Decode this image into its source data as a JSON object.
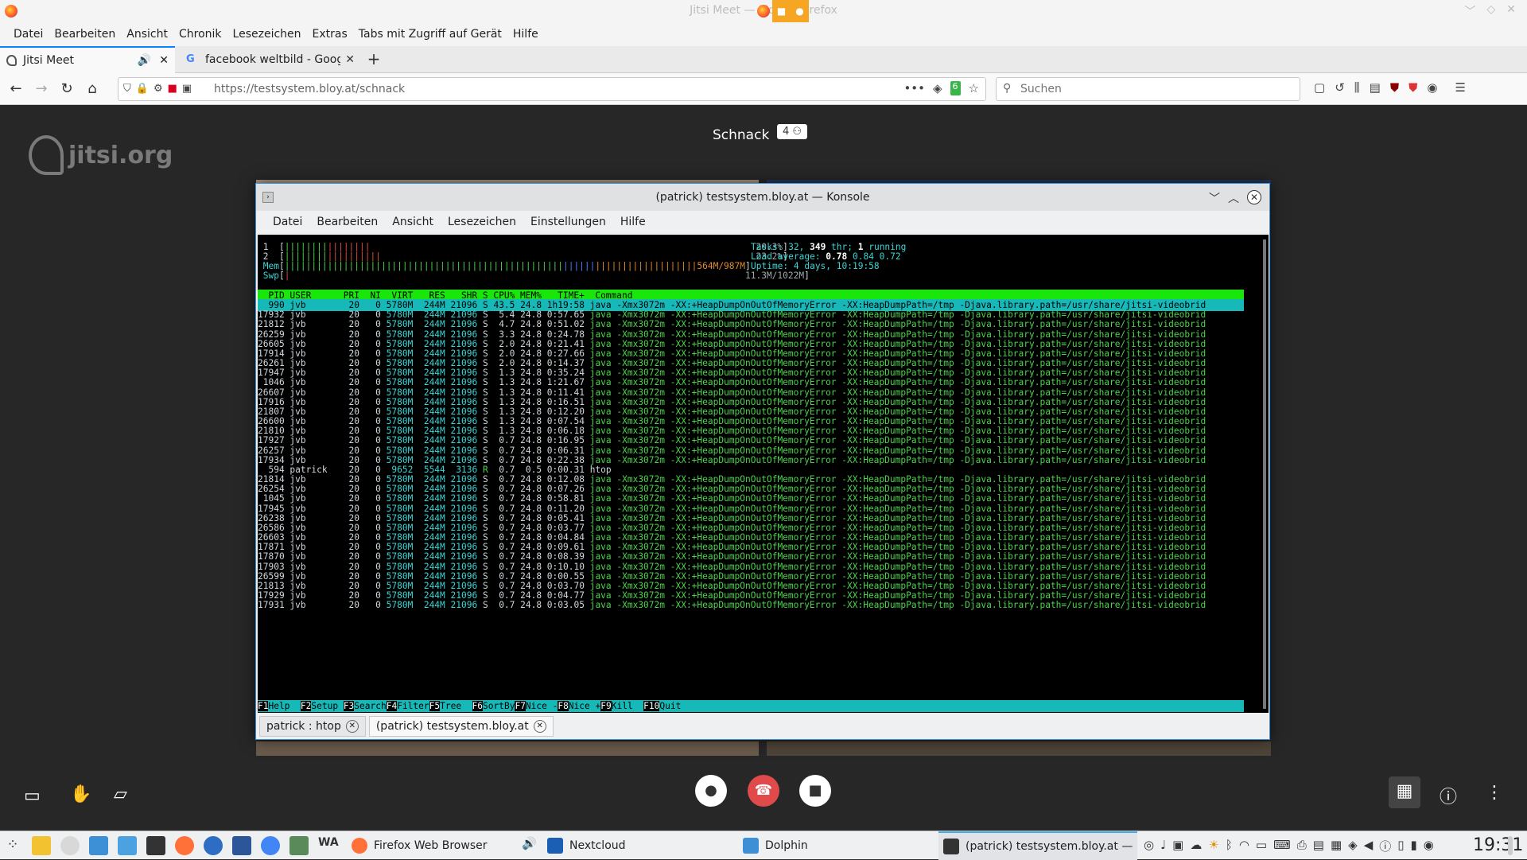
{
  "window": {
    "title": "Jitsi Meet — Mozilla Firefox"
  },
  "menubar": [
    "Datei",
    "Bearbeiten",
    "Ansicht",
    "Chronik",
    "Lesezeichen",
    "Extras",
    "Tabs mit Zugriff auf Gerät",
    "Hilfe"
  ],
  "tabs": [
    {
      "label": "Jitsi Meet",
      "active": true
    },
    {
      "label": "facebook weltbild - Google"
    }
  ],
  "url": "https://testsystem.bloy.at/schnack",
  "url_badge": "6",
  "search": {
    "placeholder": "Suchen"
  },
  "jitsi": {
    "logo": "jitsi.org",
    "room": "Schnack",
    "participants": "4"
  },
  "konsole": {
    "title": "(patrick) testsystem.bloy.at — Konsole",
    "menu": [
      "Datei",
      "Bearbeiten",
      "Ansicht",
      "Lesezeichen",
      "Einstellungen",
      "Hilfe"
    ],
    "tabs": [
      "patrick : htop",
      "(patrick) testsystem.bloy.at"
    ]
  },
  "htop": {
    "cpu1": "20.3%",
    "cpu2": "23.2%",
    "mem": "564M/987M",
    "swp": "11.3M/1022M",
    "tasks_line": [
      "Tasks: 32, ",
      "349",
      " thr; ",
      "1",
      " running"
    ],
    "load_line": [
      "Load average: ",
      "0.78",
      " 0.84 0.72"
    ],
    "uptime": "Uptime: 4 days, 10:19:58",
    "header": "  PID USER      PRI  NI  VIRT   RES   SHR S CPU% MEM%   TIME+  Command",
    "cmd": "java -Xmx3072m -XX:+HeapDumpOnOutOfMemoryError -XX:HeapDumpPath=/tmp -Djava.library.path=/usr/share/jitsi-videobrid",
    "rows": [
      [
        "990",
        "jvb",
        "20",
        "0",
        "5780M",
        "244M",
        "21096",
        "S",
        "43.5",
        "24.8",
        "1h19:58"
      ],
      [
        "17932",
        "jvb",
        "20",
        "0",
        "5780M",
        "244M",
        "21096",
        "S",
        "5.4",
        "24.8",
        "0:57.65"
      ],
      [
        "21812",
        "jvb",
        "20",
        "0",
        "5780M",
        "244M",
        "21096",
        "S",
        "4.7",
        "24.8",
        "0:51.02"
      ],
      [
        "26259",
        "jvb",
        "20",
        "0",
        "5780M",
        "244M",
        "21096",
        "S",
        "3.3",
        "24.8",
        "0:24.78"
      ],
      [
        "26605",
        "jvb",
        "20",
        "0",
        "5780M",
        "244M",
        "21096",
        "S",
        "2.0",
        "24.8",
        "0:21.41"
      ],
      [
        "17914",
        "jvb",
        "20",
        "0",
        "5780M",
        "244M",
        "21096",
        "S",
        "2.0",
        "24.8",
        "0:27.66"
      ],
      [
        "26261",
        "jvb",
        "20",
        "0",
        "5780M",
        "244M",
        "21096",
        "S",
        "2.0",
        "24.8",
        "0:14.37"
      ],
      [
        "17947",
        "jvb",
        "20",
        "0",
        "5780M",
        "244M",
        "21096",
        "S",
        "1.3",
        "24.8",
        "0:35.24"
      ],
      [
        "1046",
        "jvb",
        "20",
        "0",
        "5780M",
        "244M",
        "21096",
        "S",
        "1.3",
        "24.8",
        "1:21.67"
      ],
      [
        "26607",
        "jvb",
        "20",
        "0",
        "5780M",
        "244M",
        "21096",
        "S",
        "1.3",
        "24.8",
        "0:11.41"
      ],
      [
        "17916",
        "jvb",
        "20",
        "0",
        "5780M",
        "244M",
        "21096",
        "S",
        "1.3",
        "24.8",
        "0:16.51"
      ],
      [
        "21807",
        "jvb",
        "20",
        "0",
        "5780M",
        "244M",
        "21096",
        "S",
        "1.3",
        "24.8",
        "0:12.20"
      ],
      [
        "26600",
        "jvb",
        "20",
        "0",
        "5780M",
        "244M",
        "21096",
        "S",
        "1.3",
        "24.8",
        "0:07.54"
      ],
      [
        "21810",
        "jvb",
        "20",
        "0",
        "5780M",
        "244M",
        "21096",
        "S",
        "1.3",
        "24.8",
        "0:06.18"
      ],
      [
        "17927",
        "jvb",
        "20",
        "0",
        "5780M",
        "244M",
        "21096",
        "S",
        "0.7",
        "24.8",
        "0:16.95"
      ],
      [
        "26257",
        "jvb",
        "20",
        "0",
        "5780M",
        "244M",
        "21096",
        "S",
        "0.7",
        "24.8",
        "0:06.31"
      ],
      [
        "17934",
        "jvb",
        "20",
        "0",
        "5780M",
        "244M",
        "21096",
        "S",
        "0.7",
        "24.8",
        "0:22.38"
      ],
      [
        "594",
        "patrick",
        "20",
        "0",
        "9652",
        "5544",
        "3136",
        "R",
        "0.7",
        "0.5",
        "0:00.31",
        "htop"
      ],
      [
        "21814",
        "jvb",
        "20",
        "0",
        "5780M",
        "244M",
        "21096",
        "S",
        "0.7",
        "24.8",
        "0:12.08"
      ],
      [
        "26254",
        "jvb",
        "20",
        "0",
        "5780M",
        "244M",
        "21096",
        "S",
        "0.7",
        "24.8",
        "0:07.26"
      ],
      [
        "1045",
        "jvb",
        "20",
        "0",
        "5780M",
        "244M",
        "21096",
        "S",
        "0.7",
        "24.8",
        "0:58.81"
      ],
      [
        "17945",
        "jvb",
        "20",
        "0",
        "5780M",
        "244M",
        "21096",
        "S",
        "0.7",
        "24.8",
        "0:11.20"
      ],
      [
        "26238",
        "jvb",
        "20",
        "0",
        "5780M",
        "244M",
        "21096",
        "S",
        "0.7",
        "24.8",
        "0:05.41"
      ],
      [
        "26586",
        "jvb",
        "20",
        "0",
        "5780M",
        "244M",
        "21096",
        "S",
        "0.7",
        "24.8",
        "0:03.77"
      ],
      [
        "26603",
        "jvb",
        "20",
        "0",
        "5780M",
        "244M",
        "21096",
        "S",
        "0.7",
        "24.8",
        "0:04.84"
      ],
      [
        "17871",
        "jvb",
        "20",
        "0",
        "5780M",
        "244M",
        "21096",
        "S",
        "0.7",
        "24.8",
        "0:09.61"
      ],
      [
        "17870",
        "jvb",
        "20",
        "0",
        "5780M",
        "244M",
        "21096",
        "S",
        "0.7",
        "24.8",
        "0:08.39"
      ],
      [
        "17903",
        "jvb",
        "20",
        "0",
        "5780M",
        "244M",
        "21096",
        "S",
        "0.7",
        "24.8",
        "0:10.10"
      ],
      [
        "26599",
        "jvb",
        "20",
        "0",
        "5780M",
        "244M",
        "21096",
        "S",
        "0.7",
        "24.8",
        "0:00.55"
      ],
      [
        "21813",
        "jvb",
        "20",
        "0",
        "5780M",
        "244M",
        "21096",
        "S",
        "0.7",
        "24.8",
        "0:03.70"
      ],
      [
        "17929",
        "jvb",
        "20",
        "0",
        "5780M",
        "244M",
        "21096",
        "S",
        "0.7",
        "24.8",
        "0:04.77"
      ],
      [
        "17931",
        "jvb",
        "20",
        "0",
        "5780M",
        "244M",
        "21096",
        "S",
        "0.7",
        "24.8",
        "0:03.05"
      ]
    ],
    "fkeys": [
      [
        "F1",
        "Help"
      ],
      [
        "F2",
        "Setup"
      ],
      [
        "F3",
        "Search"
      ],
      [
        "F4",
        "Filter"
      ],
      [
        "F5",
        "Tree"
      ],
      [
        "F6",
        "SortBy"
      ],
      [
        "F7",
        "Nice -"
      ],
      [
        "F8",
        "Nice +"
      ],
      [
        "F9",
        "Kill"
      ],
      [
        "F10",
        "Quit"
      ]
    ]
  },
  "taskbar": {
    "tasks": [
      "Firefox Web Browser",
      "Nextcloud",
      "Dolphin",
      "(patrick) testsystem.bloy.at — Ko..."
    ],
    "clock": "19:31"
  },
  "colors": {
    "accent": "#3daee9",
    "htop_header": "#19e60b",
    "htop_select": "#17b8b8",
    "hangup": "#e04a4a"
  }
}
